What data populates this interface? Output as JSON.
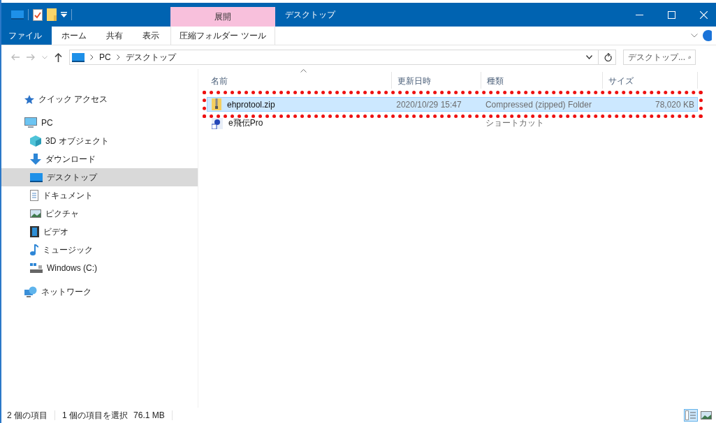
{
  "window": {
    "title": "デスクトップ",
    "contextual_tab_group": "展開"
  },
  "ribbon_tabs": [
    {
      "label": "ファイル",
      "kind": "file",
      "selected": false
    },
    {
      "label": "ホーム",
      "kind": "normal",
      "selected": false
    },
    {
      "label": "共有",
      "kind": "normal",
      "selected": false
    },
    {
      "label": "表示",
      "kind": "normal",
      "selected": false
    },
    {
      "label": "圧縮フォルダー ツール",
      "kind": "contextual",
      "selected": false
    }
  ],
  "address": {
    "path": [
      "PC",
      "デスクトップ"
    ]
  },
  "search": {
    "placeholder": "デスクトップ..."
  },
  "navigation": [
    {
      "label": "クイック アクセス",
      "kind": "star",
      "selected": false
    },
    {
      "label": "PC",
      "kind": "pc",
      "selected": false,
      "children": [
        {
          "label": "3D オブジェクト",
          "kind": "cube",
          "selected": false
        },
        {
          "label": "ダウンロード",
          "kind": "download",
          "selected": false
        },
        {
          "label": "デスクトップ",
          "kind": "desktop",
          "selected": true
        },
        {
          "label": "ドキュメント",
          "kind": "document",
          "selected": false
        },
        {
          "label": "ピクチャ",
          "kind": "picture",
          "selected": false
        },
        {
          "label": "ビデオ",
          "kind": "video",
          "selected": false
        },
        {
          "label": "ミュージック",
          "kind": "music",
          "selected": false
        },
        {
          "label": "Windows (C:)",
          "kind": "drive",
          "selected": false
        }
      ]
    },
    {
      "label": "ネットワーク",
      "kind": "network",
      "selected": false
    }
  ],
  "table": {
    "columns": [
      "名前",
      "更新日時",
      "種類",
      "サイズ"
    ],
    "rows": [
      {
        "kind": "zip",
        "name": "ehprotool.zip",
        "modified": "2020/10/29 15:47",
        "type": "Compressed (zipped) Folder",
        "size": "78,020 KB",
        "selected": true
      },
      {
        "kind": "shortcut",
        "name": "e飛伝Pro",
        "type": "ショートカット",
        "selected": false
      }
    ]
  },
  "status_bar": {
    "item_count": "2 個の項目",
    "selection": "1 個の項目を選択",
    "selection_size": "76.1 MB"
  },
  "views": [
    {
      "kind": "details",
      "selected": true
    },
    {
      "kind": "large_icons",
      "selected": false
    }
  ]
}
